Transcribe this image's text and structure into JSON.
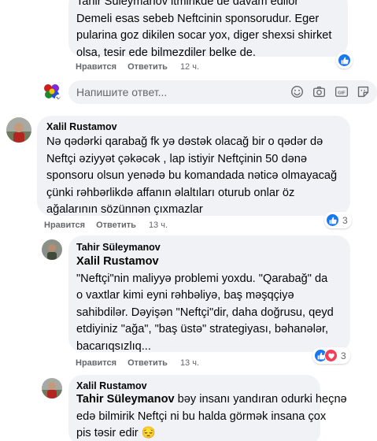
{
  "comments": [
    {
      "id": "c1",
      "author": "Tahir Süleymanov",
      "lines": [
        "Tahir Süleymanov itmirikde de davam edilor",
        "Demeli esas sebeb Neftcinin sponsorudur. Eger",
        "pularina goz dikilen socar yox, diger shexsi shirket",
        "olsa, tesir ede bilmezdiler belke de."
      ],
      "like_label": "Нравится",
      "reply_label": "Ответить",
      "time": "12 ч."
    },
    {
      "id": "c2",
      "author": "Xalil Rustamov",
      "lines": [
        "Nə qədərki qarabağ fk yə dəstək olacağ bir o qədər də",
        "Neftçi əziyyət çəkəcək , lap istiyir Neftçinin 50 dənə",
        "sponsoru olsun yenədə bu komandada nəticə olmayacağ",
        "çünki rəhbərlikdə affanın əlaltıları oturub onlar öz",
        "ağalarının sözünnən çıxmazlar"
      ],
      "like_label": "Нравится",
      "reply_label": "Ответить",
      "time": "13 ч.",
      "reaction_count": "3"
    },
    {
      "id": "c3",
      "author": "Tahir Süleymanov",
      "mention": "Xalil Rustamov",
      "lines": [
        "\"Neftçi\"nin maliyyə problemi yoxdu. \"Qarabağ\" da",
        "o vaxtlar kimi eyni rəhbəliyə, baş məşqçiyə",
        "sahibdilər. Dəyişən \"Neftçi\"dir, daha doğrusu, qeyd",
        "etdiyiniz \"ağa\", \"baş üstə\" strategiyası, bəhanələr,",
        "bacarıqsızlıq..."
      ],
      "like_label": "Нравится",
      "reply_label": "Ответить",
      "time": "13 ч.",
      "reaction_count": "3"
    },
    {
      "id": "c4",
      "author": "Xalil Rustamov",
      "mention": "Tahir Süleymanov",
      "first_line_rest": " bəy insanı yandıran odurki heçnə",
      "lines": [
        "edə bilmirik Neftçi ni bu halda görmək insana çox",
        "pis təsir edir 😔"
      ]
    }
  ],
  "reply_input": {
    "placeholder": "Напишите ответ..."
  },
  "icons": [
    "smile-icon",
    "camera-icon",
    "gif-icon",
    "sticker-icon",
    "like-icon",
    "love-icon"
  ],
  "colors": {
    "bubble": "#f0f2f5",
    "text": "#050505",
    "secondary": "#65676b",
    "like_blue": "#1877f2",
    "love_red": "#f33e58"
  }
}
